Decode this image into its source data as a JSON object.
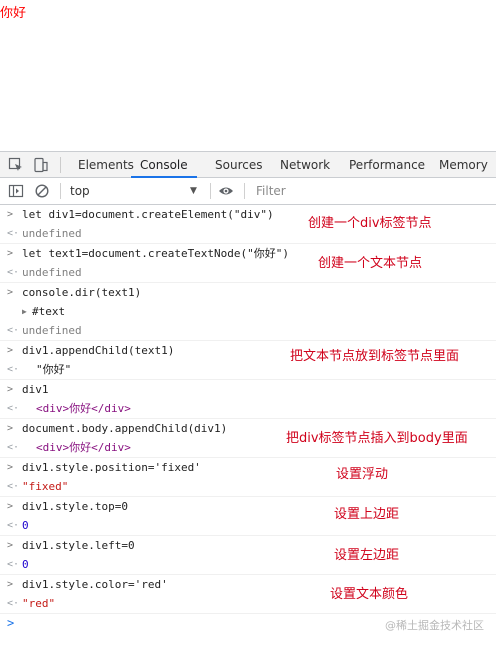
{
  "page": {
    "body_text": "你好",
    "text_color": "#ff0000"
  },
  "devtools": {
    "tabs": [
      {
        "label": "Elements"
      },
      {
        "label": "Console",
        "active": true
      },
      {
        "label": "Sources"
      },
      {
        "label": "Network"
      },
      {
        "label": "Performance"
      },
      {
        "label": "Memory"
      }
    ],
    "toolbar": {
      "context": "top",
      "filter_placeholder": "Filter"
    }
  },
  "console": {
    "entries": [
      {
        "type": "input",
        "text": "let div1=document.createElement(\"div\")",
        "annotation": "创建一个div标签节点"
      },
      {
        "type": "output",
        "text": "undefined"
      },
      {
        "type": "input",
        "text": "let text1=document.createTextNode(\"你好\")",
        "annotation": "创建一个文本节点"
      },
      {
        "type": "output",
        "text": "undefined"
      },
      {
        "type": "input",
        "text": "console.dir(text1)"
      },
      {
        "type": "log",
        "text": "#text"
      },
      {
        "type": "output",
        "text": "undefined"
      },
      {
        "type": "input",
        "text": "div1.appendChild(text1)",
        "annotation": "把文本节点放到标签节点里面"
      },
      {
        "type": "output",
        "text": "\"你好\""
      },
      {
        "type": "input",
        "text": "div1"
      },
      {
        "type": "output",
        "text": "<div>你好</div>"
      },
      {
        "type": "input",
        "text": "document.body.appendChild(div1)",
        "annotation": "把div标签节点插入到body里面"
      },
      {
        "type": "output",
        "text": "<div>你好</div>"
      },
      {
        "type": "input",
        "text": "div1.style.position='fixed'",
        "annotation": "设置浮动"
      },
      {
        "type": "output",
        "text": "\"fixed\""
      },
      {
        "type": "input",
        "text": "div1.style.top=0",
        "annotation": "设置上边距"
      },
      {
        "type": "output",
        "text": "0"
      },
      {
        "type": "input",
        "text": "div1.style.left=0",
        "annotation": "设置左边距"
      },
      {
        "type": "output",
        "text": "0"
      },
      {
        "type": "input",
        "text": "div1.style.color='red'",
        "annotation": "设置文本颜色"
      },
      {
        "type": "output",
        "text": "\"red\""
      }
    ],
    "prompt_symbol": ">"
  },
  "watermark": "@稀土掘金技术社区",
  "colors": {
    "accent": "#1a73e8",
    "annotation": "#d0021b"
  }
}
